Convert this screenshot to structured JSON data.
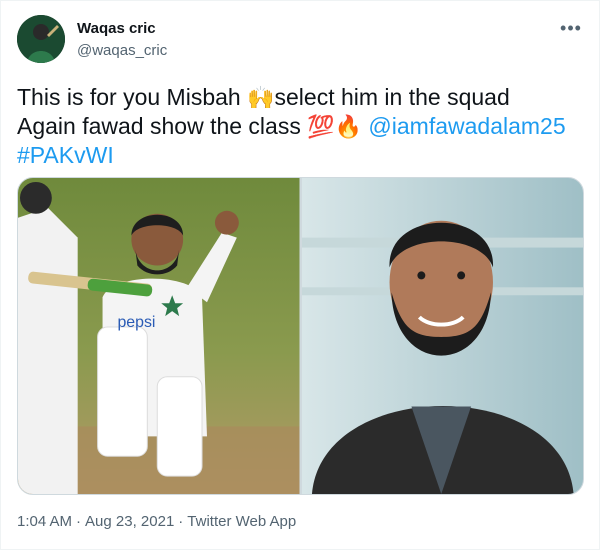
{
  "author": {
    "display_name": "Waqas cric",
    "handle": "@waqas_cric"
  },
  "menu": {
    "more_label": "•••"
  },
  "tweet": {
    "line1_text": "This is for you Misbah ",
    "line1_emoji": "🙌",
    "line1_text2": "select him in the squad",
    "line2_text": "Again fawad show the class ",
    "line2_emoji1": "💯",
    "line2_emoji2": "🔥",
    "line2_mention": "@iamfawadalam25",
    "hashtag": "#PAKvWI"
  },
  "media": {
    "left_image_icon": "cricket-player-photo",
    "right_image_icon": "coach-portrait-photo"
  },
  "meta": {
    "time": "1:04 AM",
    "date": "Aug 23, 2021",
    "separator": "·",
    "source": "Twitter Web App"
  },
  "colors": {
    "link": "#1d9bf0",
    "secondary": "#536471",
    "text": "#0f1419"
  }
}
